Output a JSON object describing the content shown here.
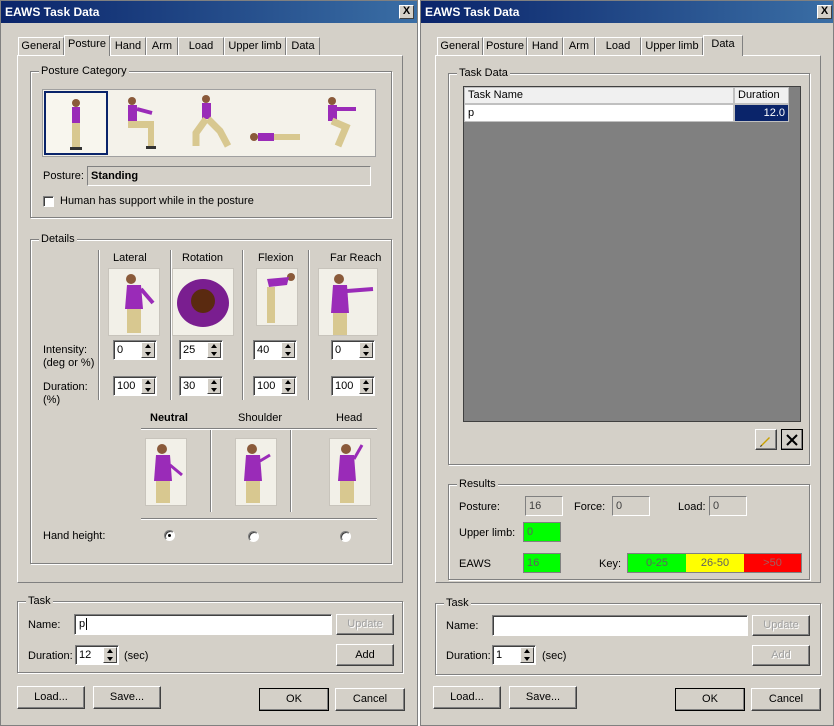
{
  "left_window": {
    "title": "EAWS Task Data",
    "close": "X",
    "tabs": [
      "General",
      "Posture",
      "Hand",
      "Arm",
      "Load",
      "Upper limb",
      "Data"
    ],
    "active_tab": "Posture",
    "posture_category": {
      "legend": "Posture Category",
      "posture_label": "Posture:",
      "posture_value": "Standing",
      "support_checkbox_label": "Human has support while in the posture",
      "support_checked": false
    },
    "details": {
      "legend": "Details",
      "columns": [
        "Lateral",
        "Rotation",
        "Flexion",
        "Far Reach"
      ],
      "intensity_label_1": "Intensity:",
      "intensity_label_2": "(deg or %)",
      "intensity_values": [
        "0",
        "25",
        "40",
        "0"
      ],
      "duration_label_1": "Duration:",
      "duration_label_2": "(%)",
      "duration_values": [
        "100",
        "30",
        "100",
        "100"
      ],
      "hand_columns": [
        "Neutral",
        "Shoulder",
        "Head"
      ],
      "hand_height_label": "Hand height:",
      "hand_height_selected": "Neutral"
    },
    "task": {
      "legend": "Task",
      "name_label": "Name:",
      "name_value": "p",
      "update_button": "Update",
      "duration_label": "Duration:",
      "duration_value": "12",
      "duration_unit": "(sec)",
      "add_button": "Add"
    },
    "load_button": "Load...",
    "save_button": "Save...",
    "ok_button": "OK",
    "cancel_button": "Cancel"
  },
  "right_window": {
    "title": "EAWS Task Data",
    "close": "X",
    "tabs": [
      "General",
      "Posture",
      "Hand",
      "Arm",
      "Load",
      "Upper limb",
      "Data"
    ],
    "active_tab": "Data",
    "task_data": {
      "legend": "Task Data",
      "headers": [
        "Task Name",
        "Duration"
      ],
      "rows": [
        {
          "name": "p",
          "duration": "12.0"
        }
      ]
    },
    "results": {
      "legend": "Results",
      "posture_label": "Posture:",
      "posture_value": "16",
      "force_label": "Force:",
      "force_value": "0",
      "load_label": "Load:",
      "load_value": "0",
      "upper_limb_label": "Upper limb:",
      "upper_limb_value": "0",
      "eaws_label": "EAWS",
      "eaws_value": "16",
      "key_label": "Key:",
      "key_ranges": [
        "0-25",
        "26-50",
        ">50"
      ],
      "colors": {
        "green": "#00ff00",
        "yellow": "#ffff00",
        "red": "#ff0000"
      }
    },
    "task": {
      "legend": "Task",
      "name_label": "Name:",
      "name_value": "",
      "update_button": "Update",
      "duration_label": "Duration:",
      "duration_value": "1",
      "duration_unit": "(sec)",
      "add_button": "Add"
    },
    "load_button": "Load...",
    "save_button": "Save...",
    "ok_button": "OK",
    "cancel_button": "Cancel"
  }
}
